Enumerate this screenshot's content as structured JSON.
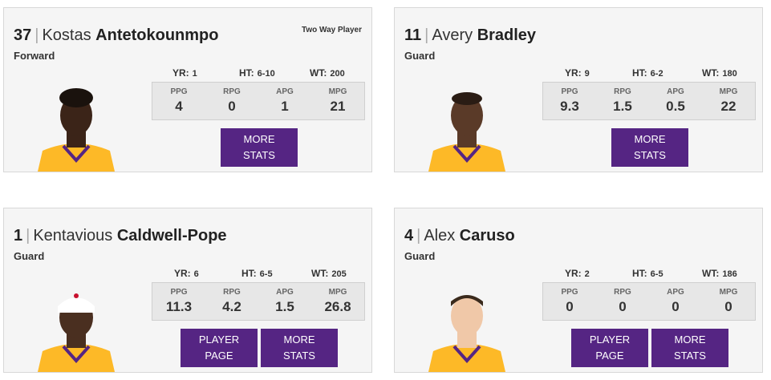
{
  "bio_labels": {
    "yr": "YR:",
    "ht": "HT:",
    "wt": "WT:"
  },
  "stat_labels": {
    "ppg": "PPG",
    "rpg": "RPG",
    "apg": "APG",
    "mpg": "MPG"
  },
  "buttons": {
    "more_stats_line1": "MORE",
    "more_stats_line2": "STATS",
    "player_page_line1": "PLAYER",
    "player_page_line2": "PAGE"
  },
  "colors": {
    "purple": "#552583",
    "gold": "#FDB927"
  },
  "players": [
    {
      "number": "37",
      "first": "Kostas",
      "last": "Antetokounmpo",
      "position": "Forward",
      "tag": "Two Way Player",
      "yr": "1",
      "ht": "6-10",
      "wt": "200",
      "ppg": "4",
      "rpg": "0",
      "apg": "1",
      "mpg": "21"
    },
    {
      "number": "11",
      "first": "Avery",
      "last": "Bradley",
      "position": "Guard",
      "tag": "",
      "yr": "9",
      "ht": "6-2",
      "wt": "180",
      "ppg": "9.3",
      "rpg": "1.5",
      "apg": "0.5",
      "mpg": "22"
    },
    {
      "number": "1",
      "first": "Kentavious",
      "last": "Caldwell-Pope",
      "position": "Guard",
      "tag": "",
      "yr": "6",
      "ht": "6-5",
      "wt": "205",
      "ppg": "11.3",
      "rpg": "4.2",
      "apg": "1.5",
      "mpg": "26.8"
    },
    {
      "number": "4",
      "first": "Alex",
      "last": "Caruso",
      "position": "Guard",
      "tag": "",
      "yr": "2",
      "ht": "6-5",
      "wt": "186",
      "ppg": "0",
      "rpg": "0",
      "apg": "0",
      "mpg": "0"
    }
  ]
}
